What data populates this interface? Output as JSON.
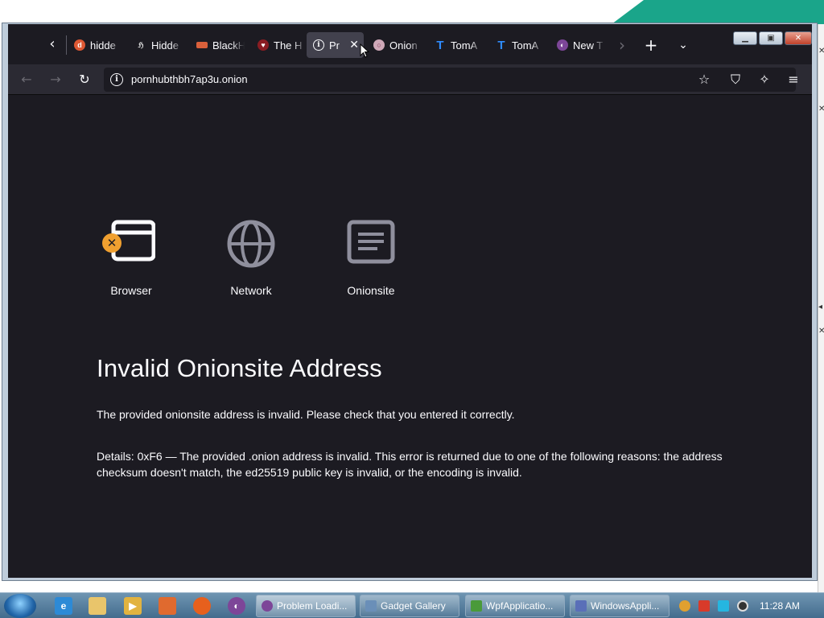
{
  "browser": {
    "tabs": [
      {
        "title": "hidde",
        "favicon": "duckduckgo-favicon",
        "color": "#de5833"
      },
      {
        "title": "Hidde",
        "favicon": "hidden-wiki-favicon",
        "color": "#1c1b22"
      },
      {
        "title": "BlackH",
        "favicon": "blackhat-favicon",
        "color": "#d9603b"
      },
      {
        "title": "The H",
        "favicon": "hub-favicon",
        "color": "#8a1c22"
      },
      {
        "title": "Pr",
        "favicon": "info-icon",
        "color": "#42414d",
        "active": true
      },
      {
        "title": "Onion",
        "favicon": "onion-favicon",
        "color": "#cfa8b8"
      },
      {
        "title": "TomA",
        "favicon": "t-favicon",
        "color": "#2f8cff"
      },
      {
        "title": "TomA",
        "favicon": "t-favicon",
        "color": "#2f8cff"
      },
      {
        "title": "New T",
        "favicon": "tor-favicon",
        "color": "#7d4698"
      }
    ],
    "url": "pornhubthbh7ap3u.onion"
  },
  "error_page": {
    "icons": [
      {
        "label": "Browser",
        "icon": "browser-icon",
        "has_error": true
      },
      {
        "label": "Network",
        "icon": "globe-icon"
      },
      {
        "label": "Onionsite",
        "icon": "onionsite-icon"
      }
    ],
    "title": "Invalid Onionsite Address",
    "message": "The provided onionsite address is invalid. Please check that you entered it correctly.",
    "details": "Details: 0xF6 — The provided .onion address is invalid. This error is returned due to one of the following reasons: the address checksum doesn't match, the ed25519 public key is invalid, or the encoding is invalid.",
    "error_badge_color": "#f0a030"
  },
  "taskbar": {
    "tasks": [
      {
        "label": "Problem Loadi...",
        "icon": "tor-icon",
        "active": true
      },
      {
        "label": "Gadget Gallery",
        "icon": "gadget-icon"
      },
      {
        "label": "WpfApplicatio...",
        "icon": "csharp-icon"
      },
      {
        "label": "WindowsAppli...",
        "icon": "vb-icon"
      }
    ],
    "clock": "11:28 AM"
  }
}
